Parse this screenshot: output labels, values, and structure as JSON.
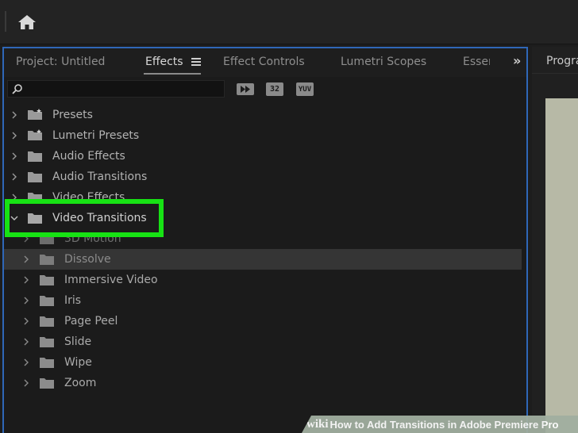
{
  "header": {
    "home_icon": "home-icon"
  },
  "effects_panel": {
    "tabs": [
      "Project: Untitled",
      "Effects",
      "Effect Controls",
      "Lumetri Scopes",
      "Esser"
    ],
    "active_tab": "Effects",
    "search": {
      "value": "",
      "placeholder": ""
    },
    "filter_chips": [
      "32",
      "YUV"
    ],
    "tree": [
      {
        "label": "Presets",
        "expanded": false
      },
      {
        "label": "Lumetri Presets",
        "expanded": false
      },
      {
        "label": "Audio Effects",
        "expanded": false
      },
      {
        "label": "Audio Transitions",
        "expanded": false
      },
      {
        "label": "Video Effects",
        "expanded": false
      },
      {
        "label": "Video Transitions",
        "expanded": true
      },
      {
        "label": "3D Motion",
        "expanded": false
      },
      {
        "label": "Dissolve",
        "expanded": false,
        "selected": true
      },
      {
        "label": "Immersive Video",
        "expanded": false
      },
      {
        "label": "Iris",
        "expanded": false
      },
      {
        "label": "Page Peel",
        "expanded": false
      },
      {
        "label": "Slide",
        "expanded": false
      },
      {
        "label": "Wipe",
        "expanded": false
      },
      {
        "label": "Zoom",
        "expanded": false
      }
    ],
    "highlight_color": "#17e214",
    "panel_border_color": "#2f67b8"
  },
  "program_panel": {
    "tab": "Progra"
  },
  "watermark": {
    "wiki": "wiki",
    "text": "How to Add Transitions in Adobe Premiere Pro"
  }
}
